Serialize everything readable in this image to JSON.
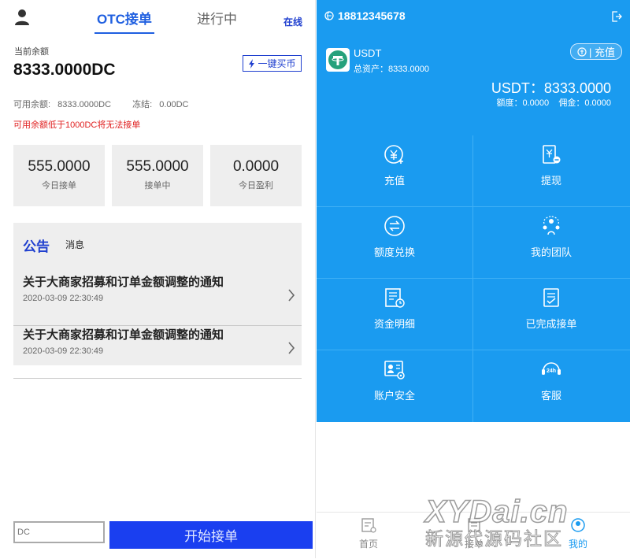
{
  "left": {
    "header": {
      "tab_otc": "OTC接单",
      "tab_progress": "进行中",
      "status": "在线"
    },
    "balance_label": "当前余额",
    "balance_value": "8333.0000DC",
    "buy_button": "一键买币",
    "available_label": "可用余额:",
    "available_value": "8333.0000DC",
    "frozen_label": "冻结:",
    "frozen_value": "0.00DC",
    "warning": "可用余额低于1000DC将无法接单",
    "stats": [
      {
        "value": "555.0000",
        "label": "今日接单"
      },
      {
        "value": "555.0000",
        "label": "接单中"
      },
      {
        "value": "0.0000",
        "label": "今日盈利"
      }
    ],
    "notice": {
      "tab_active": "公告",
      "tab_other": "消息",
      "items": [
        {
          "title": "关于大商家招募和订单金额调整的通知",
          "date": "2020-03-09 22:30:49"
        },
        {
          "title": "关于大商家招募和订单金额调整的通知",
          "date": "2020-03-09 22:30:49"
        }
      ]
    },
    "input_placeholder": "DC",
    "start_button": "开始接单"
  },
  "right": {
    "phone": "18812345678",
    "coin_name": "USDT",
    "total_assets": "总资产：8333.0000",
    "recharge_label": "| 充值",
    "usdt_amount": "USDT：8333.0000",
    "quota": "额度：0.0000    佣金：0.0000",
    "menu": [
      {
        "label": "充值",
        "icon": "yen-plus-icon"
      },
      {
        "label": "提现",
        "icon": "withdraw-icon"
      },
      {
        "label": "额度兑换",
        "icon": "exchange-icon"
      },
      {
        "label": "我的团队",
        "icon": "team-icon"
      },
      {
        "label": "资金明细",
        "icon": "ledger-icon"
      },
      {
        "label": "已完成接单",
        "icon": "completed-orders-icon"
      },
      {
        "label": "账户安全",
        "icon": "account-security-icon"
      },
      {
        "label": "客服",
        "icon": "customer-service-icon"
      }
    ],
    "nav": [
      {
        "label": "首页",
        "icon": "home-icon"
      },
      {
        "label": "接单",
        "icon": "orders-icon"
      },
      {
        "label": "我的",
        "icon": "profile-icon"
      }
    ]
  },
  "watermark": {
    "line1": "XYDai.cn",
    "line2": "新源代源码社区"
  },
  "colors": {
    "primary_blue": "#1a9bf0",
    "accent_blue": "#1f3fcf",
    "button_blue": "#1a3ff0",
    "warning_red": "#e02020"
  }
}
